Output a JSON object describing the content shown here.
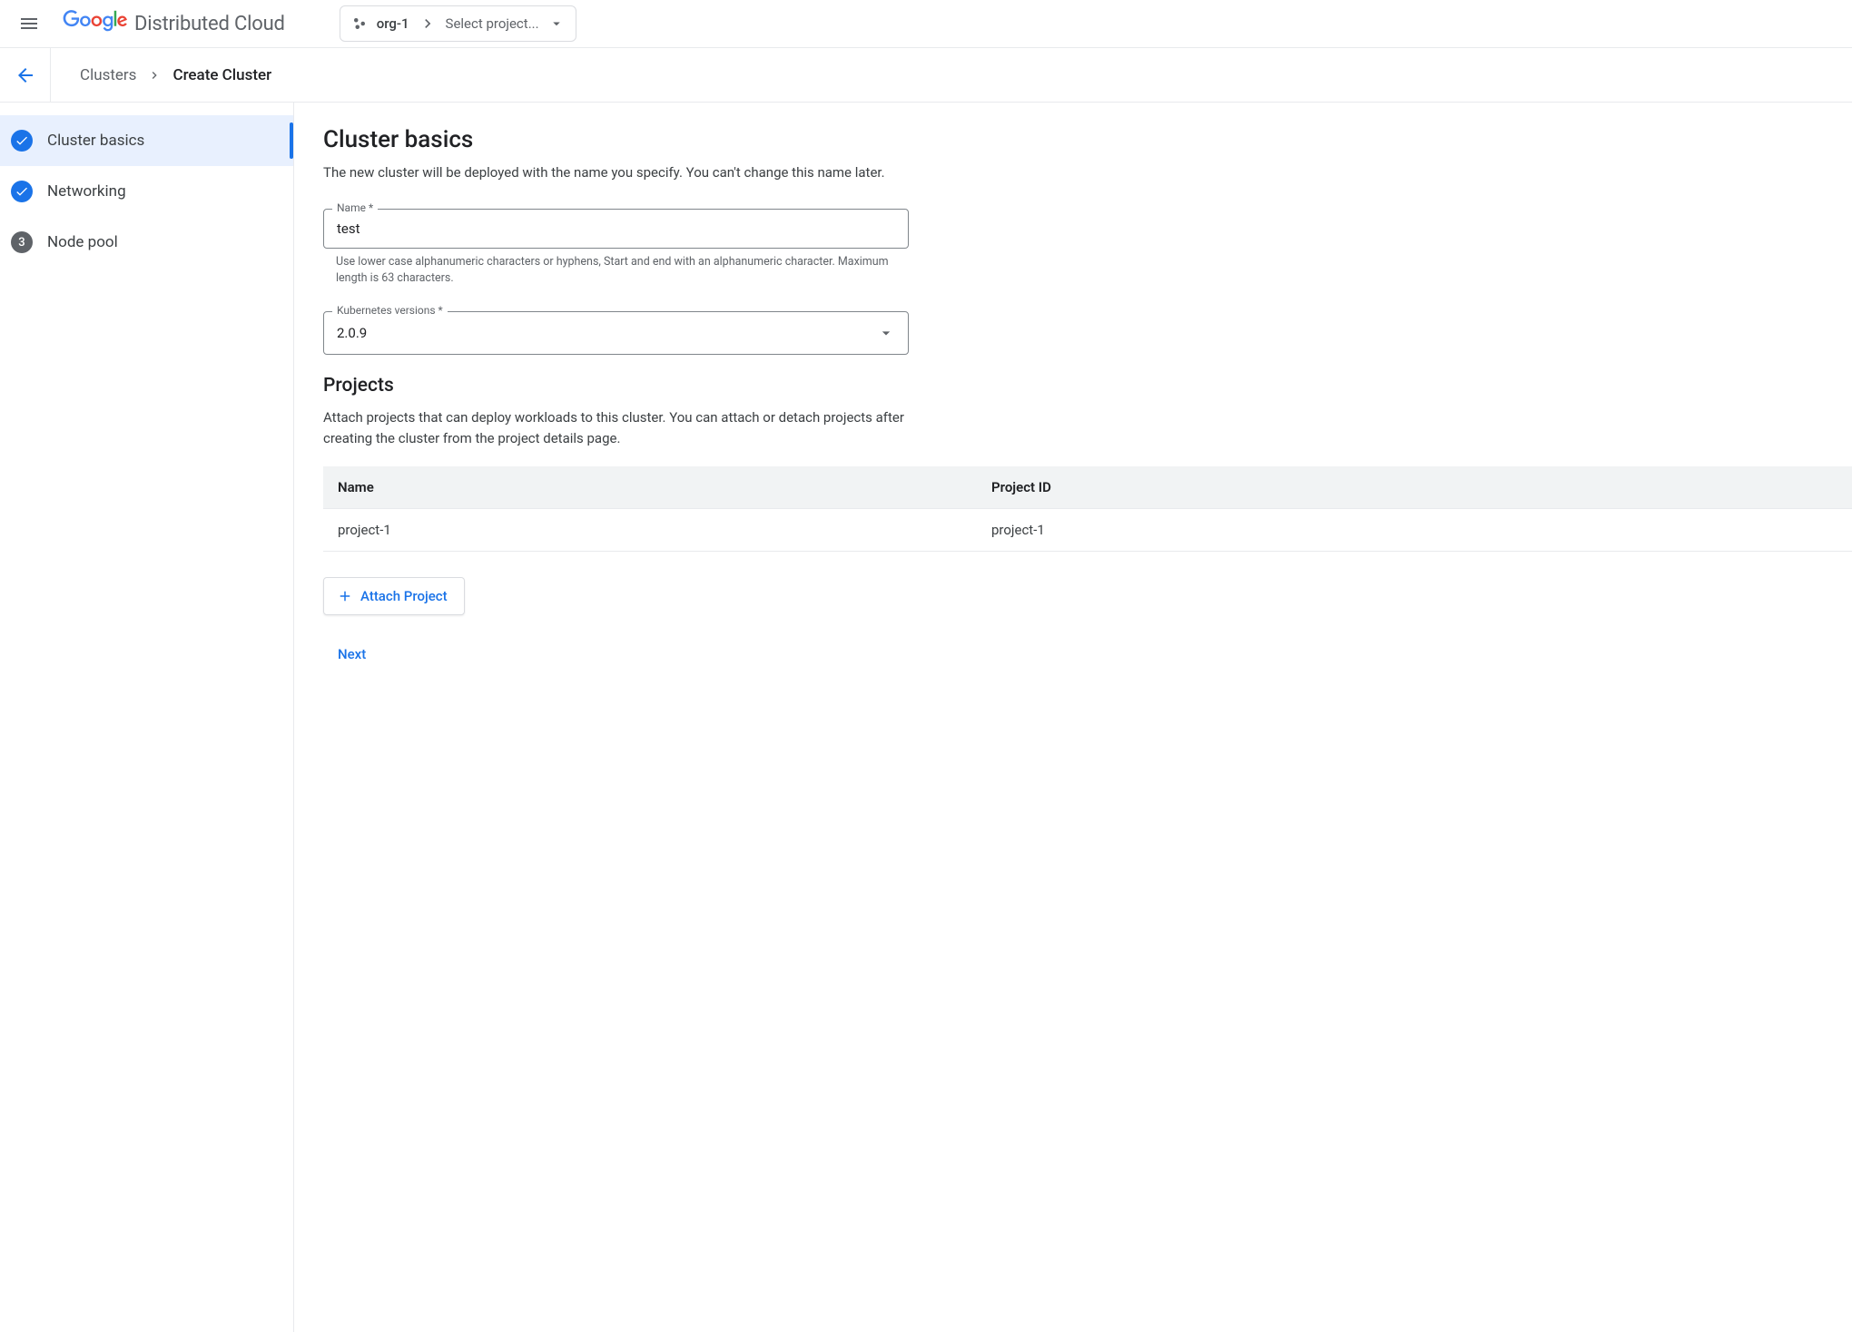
{
  "header": {
    "product_name": "Distributed Cloud",
    "org_name": "org-1",
    "project_selector": "Select project..."
  },
  "breadcrumb": {
    "parent": "Clusters",
    "current": "Create Cluster"
  },
  "sidebar": {
    "steps": [
      {
        "label": "Cluster basics",
        "state": "check",
        "active": true
      },
      {
        "label": "Networking",
        "state": "check",
        "active": false
      },
      {
        "label": "Node pool",
        "state": "num",
        "num": "3",
        "active": false
      }
    ]
  },
  "main": {
    "title": "Cluster basics",
    "description": "The new cluster will be deployed with the name you specify. You can't change this name later.",
    "name_field": {
      "label": "Name *",
      "value": "test",
      "hint": "Use lower case alphanumeric characters or hyphens, Start and end with an alphanumeric character. Maximum length is 63 characters."
    },
    "k8s_field": {
      "label": "Kubernetes versions *",
      "value": "2.0.9"
    },
    "projects": {
      "title": "Projects",
      "description": "Attach projects that can deploy workloads to this cluster. You can attach or detach projects after creating the cluster from the project details page.",
      "headers": {
        "name": "Name",
        "id": "Project ID"
      },
      "rows": [
        {
          "name": "project-1",
          "id": "project-1"
        }
      ],
      "attach_label": "Attach Project"
    },
    "next_label": "Next"
  }
}
